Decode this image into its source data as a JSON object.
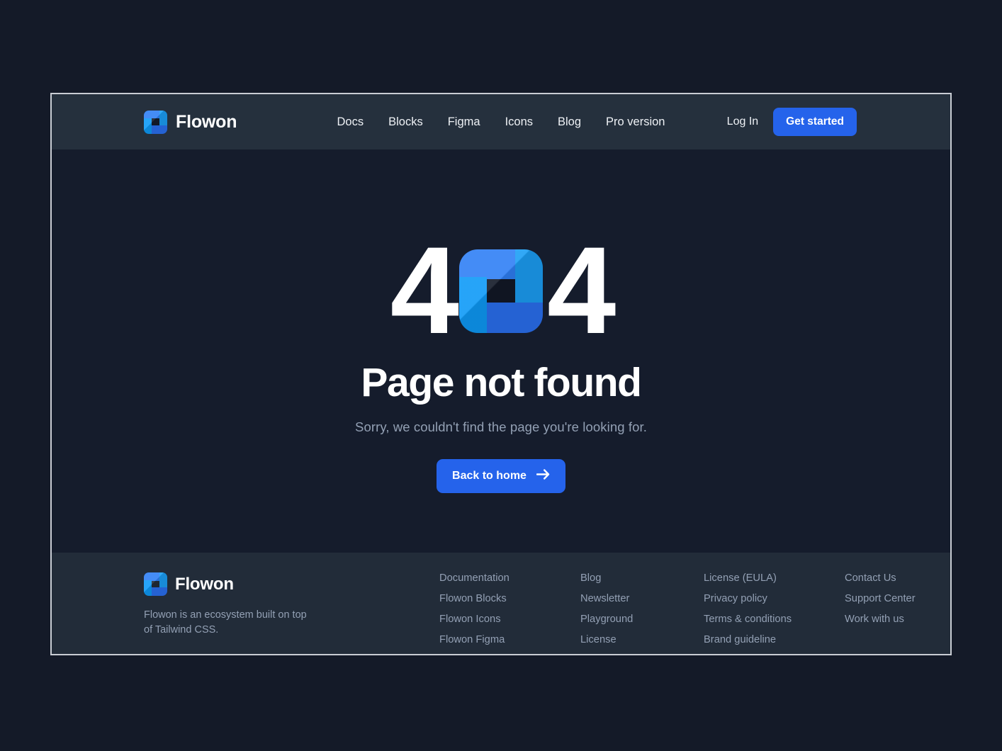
{
  "colors": {
    "page_background": "#141a28",
    "card_background": "#151c2c",
    "header_background": "#25303d",
    "footer_background": "#222c39",
    "accent": "#2563eb",
    "logo_blue": "#1b9ef5",
    "muted_text": "#93a0b4",
    "card_border": "#c9cdd4"
  },
  "header": {
    "logo_icon": "flowon-logo-icon",
    "brand_name": "Flowon",
    "nav": [
      {
        "label": "Docs"
      },
      {
        "label": "Blocks"
      },
      {
        "label": "Figma"
      },
      {
        "label": "Icons"
      },
      {
        "label": "Blog"
      },
      {
        "label": "Pro version"
      }
    ],
    "login_label": "Log In",
    "cta_label": "Get started"
  },
  "main": {
    "error_code": {
      "left_digit": "4",
      "middle_icon": "flowon-logo-icon",
      "right_digit": "4"
    },
    "headline": "Page not found",
    "subline": "Sorry, we couldn't find the page you're looking for.",
    "button_label": "Back to home",
    "button_icon": "arrow-right-icon"
  },
  "footer": {
    "logo_icon": "flowon-logo-icon",
    "brand_name": "Flowon",
    "tagline": "Flowon is an ecosystem built on top of Tailwind CSS.",
    "columns": [
      {
        "links": [
          {
            "label": "Documentation"
          },
          {
            "label": "Flowon Blocks"
          },
          {
            "label": "Flowon Icons"
          },
          {
            "label": "Flowon Figma"
          }
        ]
      },
      {
        "links": [
          {
            "label": "Blog"
          },
          {
            "label": "Newsletter"
          },
          {
            "label": "Playground"
          },
          {
            "label": "License"
          }
        ]
      },
      {
        "links": [
          {
            "label": "License (EULA)"
          },
          {
            "label": "Privacy policy"
          },
          {
            "label": "Terms & conditions"
          },
          {
            "label": "Brand guideline"
          }
        ]
      },
      {
        "links": [
          {
            "label": "Contact Us"
          },
          {
            "label": "Support Center"
          },
          {
            "label": "Work with us"
          }
        ]
      }
    ]
  }
}
